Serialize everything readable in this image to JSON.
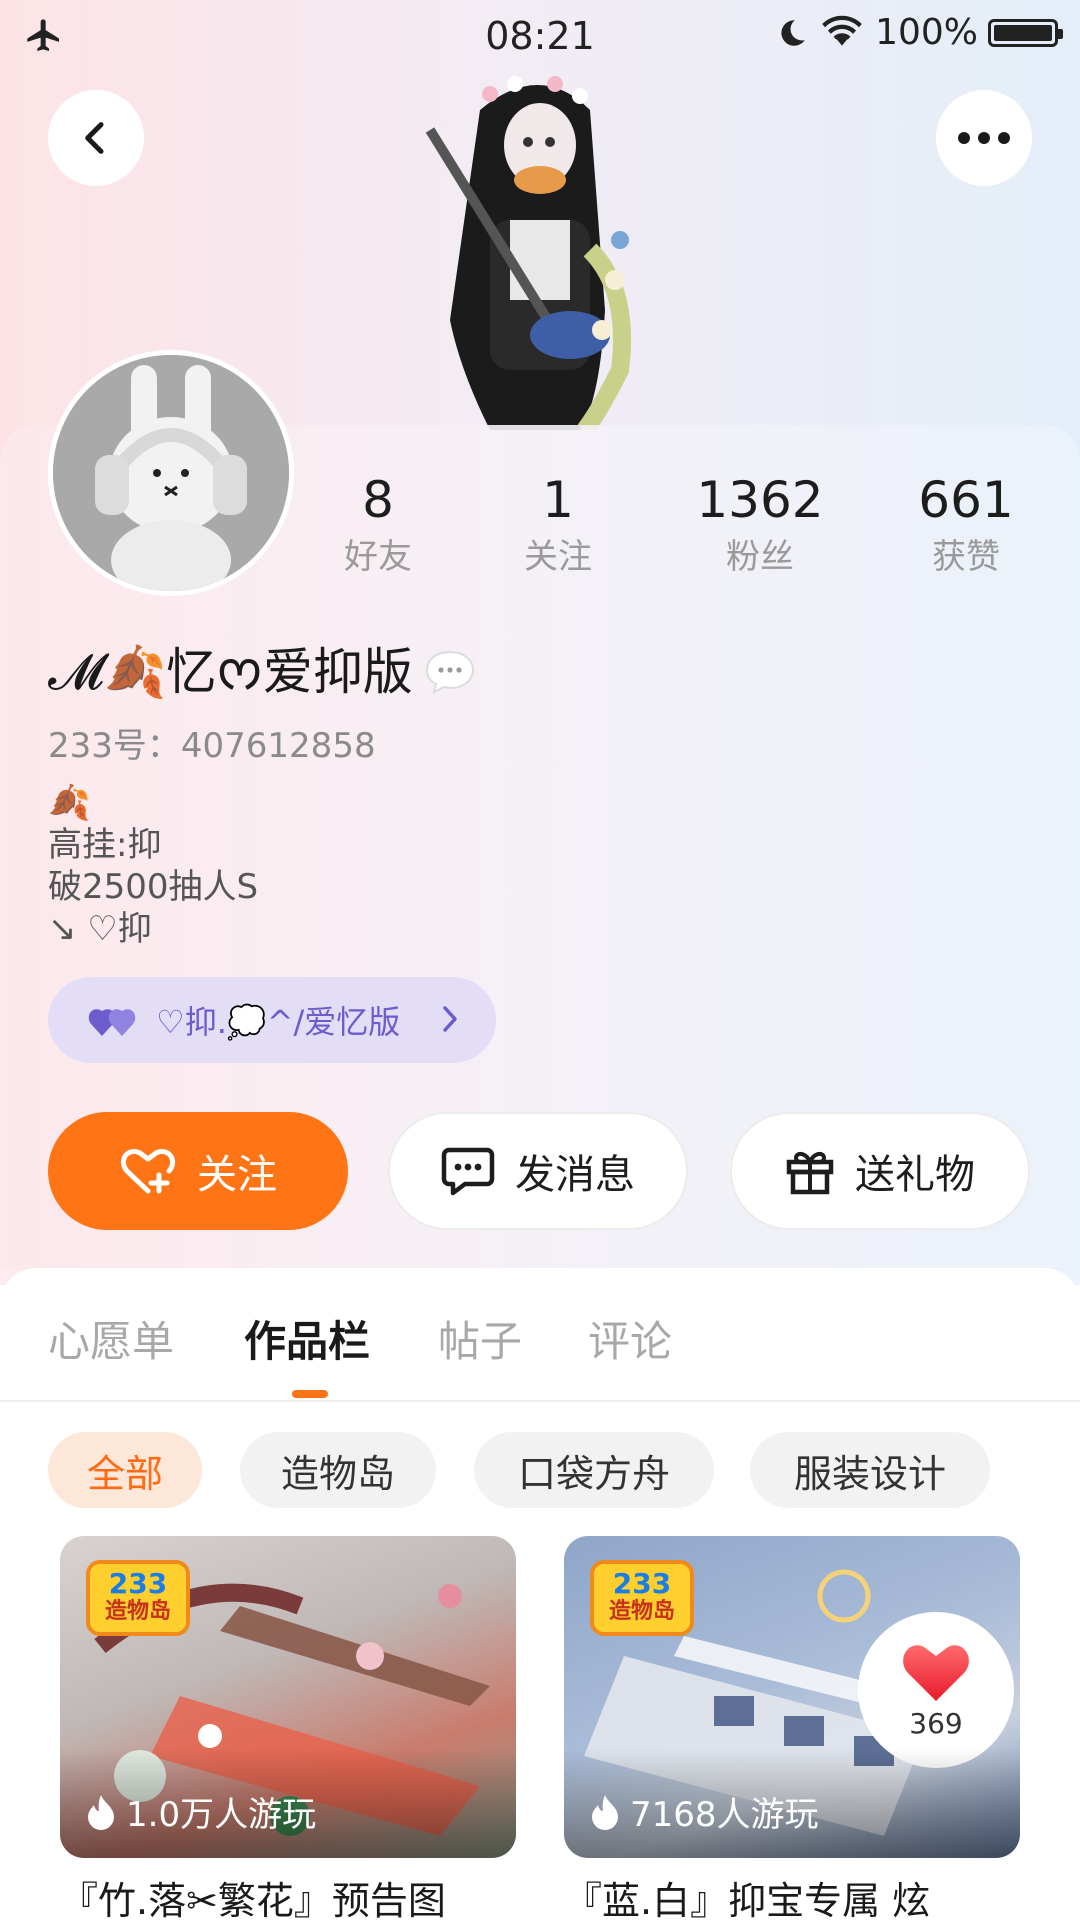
{
  "status_bar": {
    "time": "08:21",
    "battery": "100%",
    "icons": [
      "airplane-icon",
      "moon-icon",
      "wifi-icon",
      "battery-icon"
    ]
  },
  "header": {
    "back_icon": "chevron-left-icon",
    "more_icon": "more-dots-icon"
  },
  "profile": {
    "stats": [
      {
        "value": "8",
        "label": "好友"
      },
      {
        "value": "1",
        "label": "关注"
      },
      {
        "value": "1362",
        "label": "粉丝"
      },
      {
        "value": "661",
        "label": "获赞"
      }
    ],
    "nickname": "𝓜🍂忆ᰔ爱抑版",
    "uid": "233号：407612858",
    "bio_lines": [
      "🍂",
      "高挂:抑",
      "破2500抽人S",
      "↘ ♡抑"
    ],
    "tribe_label": "♡抑.💭^/爱忆版"
  },
  "actions": {
    "follow": "关注",
    "message": "发消息",
    "gift": "送礼物"
  },
  "tabs": [
    {
      "label": "心愿单",
      "active": false
    },
    {
      "label": "作品栏",
      "active": true
    },
    {
      "label": "帖子",
      "active": false
    },
    {
      "label": "评论",
      "active": false
    }
  ],
  "filters": [
    {
      "label": "全部",
      "active": true
    },
    {
      "label": "造物岛",
      "active": false
    },
    {
      "label": "口袋方舟",
      "active": false
    },
    {
      "label": "服装设计",
      "active": false
    }
  ],
  "works": [
    {
      "badge_top": "233",
      "badge_bottom": "造物岛",
      "plays": "1.0万人游玩",
      "title": "『竹.落✂繁花』预告图"
    },
    {
      "badge_top": "233",
      "badge_bottom": "造物岛",
      "plays": "7168人游玩",
      "title": "『蓝.白』抑宝专属  炫",
      "likes": "369"
    }
  ],
  "colors": {
    "accent": "#ff7414",
    "tribe_bg": "#e3def6",
    "tribe_text": "#6c5ccd"
  }
}
